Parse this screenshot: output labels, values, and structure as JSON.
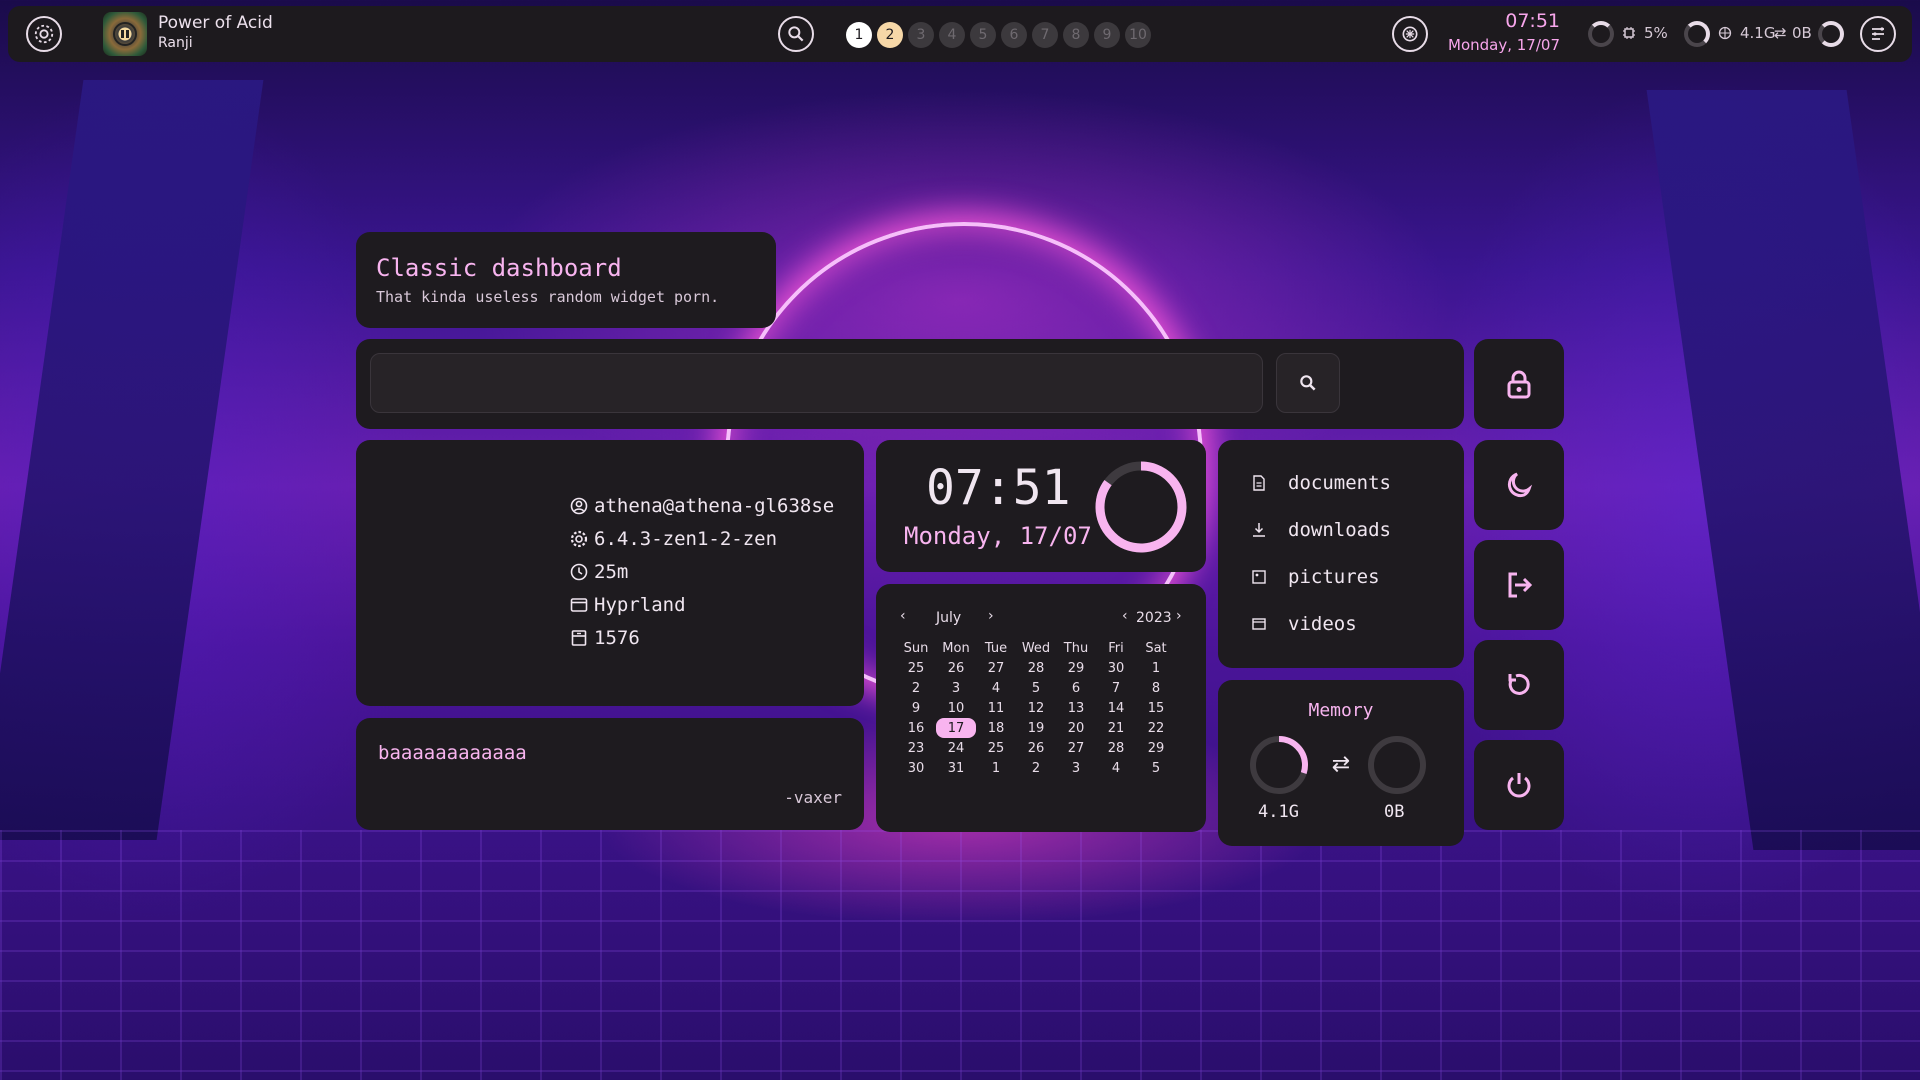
{
  "topbar": {
    "settings_icon": "gear-icon",
    "media": {
      "title": "Power of Acid",
      "artist": "Ranji",
      "state_icon": "pause-icon"
    },
    "overview_icon": "search-icon",
    "workspaces": [
      "1",
      "2",
      "3",
      "4",
      "5",
      "6",
      "7",
      "8",
      "9",
      "10"
    ],
    "active_workspace": "1",
    "occupied_workspaces": [
      "2"
    ],
    "lock_icon": "brain-icon",
    "time": "07:51",
    "date": "Monday, 17/07",
    "cpu_label": "5%",
    "cpu_percent": 5,
    "memory_label": "4.1G",
    "swap_label": "0B",
    "sidebar_icon": "menu-icon"
  },
  "dashboard": {
    "title": "Classic dashboard",
    "subtitle": "That kinda useless random widget porn."
  },
  "search": {
    "value": "",
    "placeholder": "",
    "icon": "search-icon"
  },
  "system_info": [
    {
      "icon": "user-icon",
      "text": "athena@athena-gl638se"
    },
    {
      "icon": "kernel-icon",
      "text": "6.4.3-zen1-2-zen"
    },
    {
      "icon": "clock-icon",
      "text": "25m"
    },
    {
      "icon": "window-icon",
      "text": "Hyprland"
    },
    {
      "icon": "package-icon",
      "text": "1576"
    }
  ],
  "quote": {
    "text": "baaaaaaaaaaaa",
    "author": "-vaxer"
  },
  "clock": {
    "time": "07:51",
    "date": "Monday, 17/07",
    "ring_fraction": 0.85
  },
  "calendar": {
    "month": "July",
    "year": "2023",
    "weekdays": [
      "Sun",
      "Mon",
      "Tue",
      "Wed",
      "Thu",
      "Fri",
      "Sat"
    ],
    "days": [
      "25",
      "26",
      "27",
      "28",
      "29",
      "30",
      "1",
      "2",
      "3",
      "4",
      "5",
      "6",
      "7",
      "8",
      "9",
      "10",
      "11",
      "12",
      "13",
      "14",
      "15",
      "16",
      "17",
      "18",
      "19",
      "20",
      "21",
      "22",
      "23",
      "24",
      "25",
      "26",
      "27",
      "28",
      "29",
      "30",
      "31",
      "1",
      "2",
      "3",
      "4",
      "5"
    ],
    "today": "17"
  },
  "directories": [
    {
      "icon": "file-icon",
      "label": "documents"
    },
    {
      "icon": "download-icon",
      "label": "downloads"
    },
    {
      "icon": "image-icon",
      "label": "pictures"
    },
    {
      "icon": "video-icon",
      "label": "videos"
    }
  ],
  "memory": {
    "title": "Memory",
    "ram_label": "4.1G",
    "swap_label": "0B",
    "ram_fraction": 0.3,
    "swap_fraction": 0.0
  },
  "power_buttons": [
    {
      "name": "lock",
      "icon": "lock-icon"
    },
    {
      "name": "sleep",
      "icon": "moon-icon"
    },
    {
      "name": "logout",
      "icon": "logout-icon"
    },
    {
      "name": "reboot",
      "icon": "reboot-icon"
    },
    {
      "name": "shutdown",
      "icon": "power-icon"
    }
  ],
  "colors": {
    "accent": "#f8b4ef",
    "panel": "#1e1b1f",
    "workspace_occupied": "#f6d7a7"
  }
}
